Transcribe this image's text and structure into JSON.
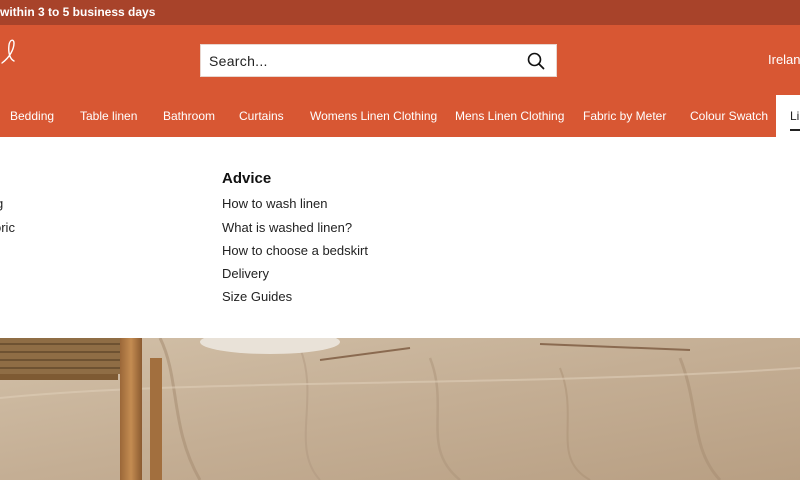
{
  "announcement": {
    "text": "within 3 to 5 business days"
  },
  "header": {
    "search_placeholder": "Search...",
    "country": "Ireland"
  },
  "nav": {
    "items": [
      {
        "label": "Bedding"
      },
      {
        "label": "Table linen"
      },
      {
        "label": "Bathroom"
      },
      {
        "label": "Curtains"
      },
      {
        "label": "Womens Linen Clothing"
      },
      {
        "label": "Mens Linen Clothing"
      },
      {
        "label": "Fabric by Meter"
      },
      {
        "label": "Colour Swatch"
      },
      {
        "label": "Li"
      }
    ]
  },
  "mega": {
    "left_links": [
      "g",
      "oric"
    ],
    "advice": {
      "title": "Advice",
      "links": [
        "How to wash linen",
        "What is washed linen?",
        "How to choose a bedskirt",
        "Delivery",
        "Size Guides"
      ]
    }
  },
  "colors": {
    "brand": "#d85733",
    "announce": "#a8432a"
  }
}
